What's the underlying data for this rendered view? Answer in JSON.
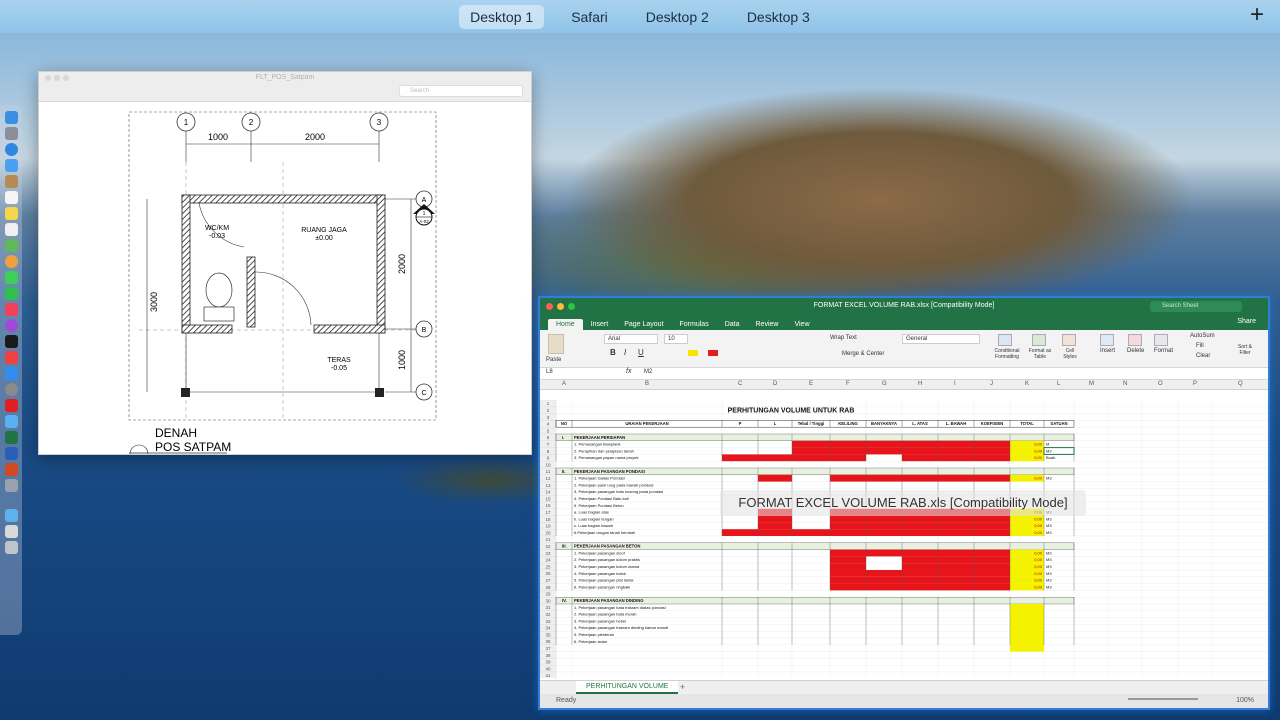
{
  "spaces": {
    "tabs": [
      "Desktop 1",
      "Safari",
      "Desktop 2",
      "Desktop 3"
    ],
    "active_index": 0,
    "add_label": "+"
  },
  "pdf_window": {
    "title": "FLT_POS_Satpam",
    "search_placeholder": "Search",
    "drawing": {
      "dim_top_left": "1000",
      "dim_top_right": "2000",
      "dim_left": "3000",
      "dim_right_top": "2000",
      "dim_right_bottom": "1000",
      "grid_labels_top": [
        "1",
        "2",
        "3"
      ],
      "grid_labels_right": [
        "A",
        "B",
        "C"
      ],
      "room_wc": "WC/KM",
      "room_wc_level": "-0.03",
      "room_jaga": "RUANG JAGA",
      "room_jaga_level": "±0.00",
      "room_teras": "TERAS",
      "room_teras_level": "-0.05",
      "section_mark": "1",
      "section_sub": "A-02",
      "caption_line1": "DENAH",
      "caption_line2": "POS SATPAM"
    }
  },
  "excel_window": {
    "title": "FORMAT EXCEL VOLUME RAB.xlsx  [Compatibility Mode]",
    "search_placeholder": "Search Sheet",
    "ribbon_tabs": [
      "Home",
      "Insert",
      "Page Layout",
      "Formulas",
      "Data",
      "Review",
      "View"
    ],
    "active_tab": "Home",
    "share_label": "Share",
    "ribbon": {
      "font_name": "Arial",
      "font_size": "10",
      "wrap_text": "Wrap Text",
      "merge_center": "Merge & Center",
      "number_format": "General",
      "conditional": "Conditional Formatting",
      "format_table": "Format as Table",
      "cell_styles": "Cell Styles",
      "insert": "Insert",
      "delete": "Delete",
      "format": "Format",
      "autosum": "AutoSum",
      "fill": "Fill",
      "clear": "Clear",
      "sort_filter": "Sort & Filter",
      "paste": "Paste"
    },
    "name_box": "L8",
    "formula_value": "M2",
    "columns": [
      "A",
      "B",
      "C",
      "D",
      "E",
      "F",
      "G",
      "H",
      "I",
      "J",
      "K",
      "L",
      "M",
      "N",
      "O",
      "P",
      "Q"
    ],
    "sheet_title": "PERHITUNGAN VOLUME UNTUK RAB",
    "headers": [
      "NO",
      "URAIAN PEKERJAAN",
      "P",
      "L",
      "Tebal / Tinggi",
      "KELILING",
      "BANYAKNYA",
      "L. ATAS",
      "L. BAWAH",
      "KOEFISIEN",
      "TOTAL",
      "SATUAN"
    ],
    "sections": [
      {
        "no": "I.",
        "title": "PEKERJAAN PERSIAPAN",
        "items": [
          {
            "label": "1. Pemasangan Bowplank",
            "total": "0,00",
            "unit": "M"
          },
          {
            "label": "2. Perapihan dan pelapisan tanah",
            "total": "0,00",
            "unit": "M2"
          },
          {
            "label": "3. Pemasangan papan nama proyek",
            "total": "0,00",
            "unit": "Buah"
          }
        ]
      },
      {
        "no": "II.",
        "title": "PEKERJAAN PASANGAN PONDASI",
        "items": [
          {
            "label": "1. Pekerjaan Galian Pondasi",
            "total": "0,00",
            "unit": "M3"
          },
          {
            "label": "2. Pekerjaan pasir urug pada bawah pondasi",
            "total": "",
            "unit": ""
          },
          {
            "label": "3. Pekerjaan pasangan batu kosong pada pondasi",
            "total": "",
            "unit": ""
          },
          {
            "label": "4. Pekerjaan Pondasi Batu kali",
            "total": "",
            "unit": ""
          },
          {
            "label": "5. Pekerjaan Pondasi Beton",
            "total": "",
            "unit": ""
          },
          {
            "label": "a. Luas bagian atas",
            "total": "0,00",
            "unit": "M3"
          },
          {
            "label": "b. Luas bagian tengah",
            "total": "0,00",
            "unit": "M3"
          },
          {
            "label": "c. Luas bagian bawah",
            "total": "0,00",
            "unit": "M3"
          },
          {
            "label": "6.Pekerjaan urugan tanah kembali",
            "total": "0,00",
            "unit": "M3"
          }
        ]
      },
      {
        "no": "III.",
        "title": "PEKERJAAN PASANGAN BETON",
        "items": [
          {
            "label": "1. Pekerjaan pasangan sloof",
            "total": "0,00",
            "unit": "M3"
          },
          {
            "label": "2. Pekerjaan pasangan kolom praktis",
            "total": "0,00",
            "unit": "M3"
          },
          {
            "label": "3. Pekerjaan pasangan kolom utama",
            "total": "0,00",
            "unit": "M3"
          },
          {
            "label": "4. Pekerjaan pasangan balok",
            "total": "0,00",
            "unit": "M3"
          },
          {
            "label": "5. Pekerjaan pasangan plat lantai",
            "total": "0,00",
            "unit": "M3"
          },
          {
            "label": "6. Pekerjaan pasangan ringbalk",
            "total": "0,00",
            "unit": "M3"
          }
        ]
      },
      {
        "no": "IV.",
        "title": "PEKERJAAN PASANGAN DINDING",
        "items": [
          {
            "label": "1. Pekerjaan pasangan bata trasram diatas pondasi",
            "total": "",
            "unit": ""
          },
          {
            "label": "2. Pekerjaan pasangan bata merah",
            "total": "",
            "unit": ""
          },
          {
            "label": "3. Pekerjaan pasangan hebel",
            "total": "",
            "unit": ""
          },
          {
            "label": "4. Pekerjaan pasangan trasram dinding kamar mandi",
            "total": "",
            "unit": ""
          },
          {
            "label": "5. Pekerjaan plesteran",
            "total": "",
            "unit": ""
          },
          {
            "label": "6. Pekerjaan acian",
            "total": "",
            "unit": ""
          }
        ]
      }
    ],
    "sheet_tab": "PERHITUNGAN VOLUME",
    "add_sheet": "+",
    "status": "Ready",
    "zoom": "100%",
    "colors": {
      "fill_red": "#e8141c",
      "fill_yellow": "#f5f200",
      "excel_green": "#217346"
    }
  },
  "overlay_label": "FORMAT EXCEL VOLUME RAB.xls  [Compatibility Mode]"
}
